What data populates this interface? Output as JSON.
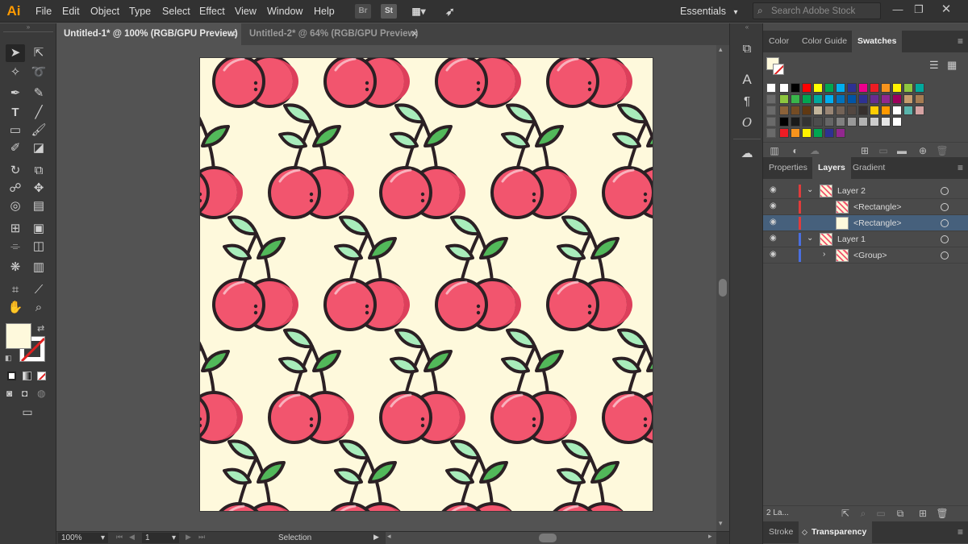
{
  "app": {
    "logo": "Ai"
  },
  "menu": [
    "File",
    "Edit",
    "Object",
    "Type",
    "Select",
    "Effect",
    "View",
    "Window",
    "Help"
  ],
  "menubar_icons": {
    "bridge": "Br",
    "stock": "St"
  },
  "workspace": {
    "label": "Essentials"
  },
  "search": {
    "placeholder": "Search Adobe Stock"
  },
  "tabs": [
    {
      "label": "Untitled-1* @ 100% (RGB/GPU Preview)",
      "active": true
    },
    {
      "label": "Untitled-2* @ 64% (RGB/GPU Preview)",
      "active": false
    }
  ],
  "statusbar": {
    "zoom": "100%",
    "page": "1",
    "tool": "Selection"
  },
  "panels": {
    "top_tabs": [
      "Color",
      "Color Guide",
      "Swatches"
    ],
    "mid_tabs": [
      "Properties",
      "Layers",
      "Gradient"
    ],
    "bottom_tabs": [
      "Stroke",
      "Transparency"
    ]
  },
  "layers": {
    "rows": [
      {
        "name": "Layer 2",
        "indent": 0,
        "expanded": true,
        "color": "#e03c3c"
      },
      {
        "name": "<Rectangle>",
        "indent": 1,
        "expanded": false,
        "color": "#e03c3c"
      },
      {
        "name": "<Rectangle>",
        "indent": 1,
        "expanded": false,
        "color": "#e03c3c",
        "selected": true
      },
      {
        "name": "Layer 1",
        "indent": 0,
        "expanded": true,
        "color": "#4a6fe0"
      },
      {
        "name": "<Group>",
        "indent": 1,
        "expanded": false,
        "color": "#4a6fe0"
      }
    ],
    "count_label": "2 La..."
  },
  "colors": {
    "artboard_bg": "#fef9dc",
    "cherry": "#f2556e",
    "cherry_shade": "#dd3f5b",
    "leaf_dark": "#52b85a",
    "leaf_light": "#a8ecbb",
    "outline": "#2b2024",
    "fill_swatch": "#fef9dc"
  }
}
